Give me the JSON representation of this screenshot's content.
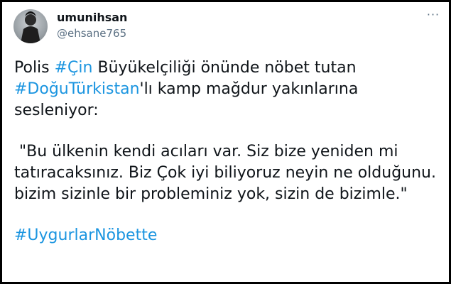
{
  "user": {
    "display_name": "umunihsan",
    "handle": "@ehsane765"
  },
  "menu": {
    "more_label": "···"
  },
  "tweet": {
    "line1_prefix": "Polis ",
    "line1_tag": "#Çin",
    "line1_suffix": " Büyükelçiliği önünde nöbet tutan",
    "line2_tag": "#DoğuTürkistan",
    "line2_suffix": "'lı kamp mağdur yakınlarına sesleniyor:",
    "quote_line1": " \"Bu ülkenin kendi acıları var. Siz bize yeniden mi",
    "quote_line2": "tatıracaksınız. Biz Çok iyi biliyoruz neyin ne olduğunu.",
    "quote_line3": "bizim sizinle bir probleminiz yok, sizin de bizimle.\"",
    "final_tag": "#UygurlarNöbette"
  },
  "colors": {
    "hashtag": "#1b95e0",
    "text": "#0f1419",
    "secondary": "#5b7083",
    "border": "#000000"
  }
}
